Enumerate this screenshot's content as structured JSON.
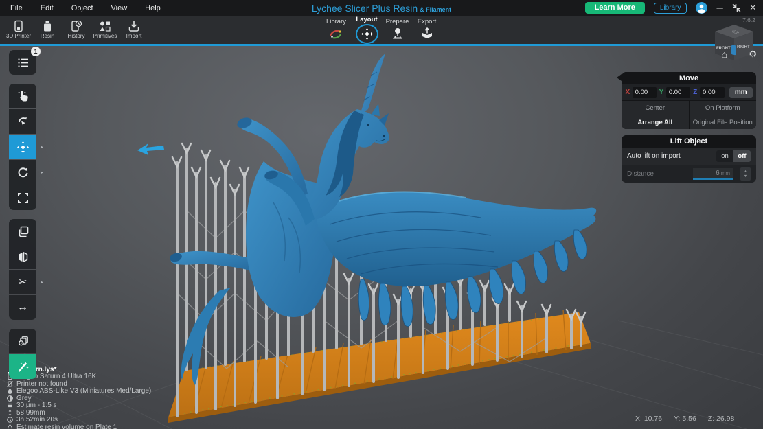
{
  "titlebar": {
    "menus": [
      "File",
      "Edit",
      "Object",
      "View",
      "Help"
    ],
    "title": "Lychee Slicer Plus Resin",
    "title_suffix": "& Filament",
    "learn_more_label": "Learn More",
    "library_label": "Library",
    "version": "7.6.2"
  },
  "toolbar": {
    "items": [
      {
        "label": "3D Printer"
      },
      {
        "label": "Resin"
      },
      {
        "label": "History"
      },
      {
        "label": "Primitives"
      },
      {
        "label": "Import"
      }
    ],
    "tabs": [
      {
        "label": "Library"
      },
      {
        "label": "Layout",
        "active": true
      },
      {
        "label": "Prepare"
      },
      {
        "label": "Export"
      }
    ]
  },
  "sidebar": {
    "scene_badge": "1"
  },
  "viewcube": {
    "top": "TOP",
    "front": "FRONT",
    "right": "RIGHT"
  },
  "panels": {
    "move": {
      "title": "Move",
      "axes": [
        {
          "label": "X",
          "value": "0.00"
        },
        {
          "label": "Y",
          "value": "0.00"
        },
        {
          "label": "Z",
          "value": "0.00"
        }
      ],
      "unit": "mm",
      "buttons": [
        "Center",
        "On Platform",
        "Arrange All",
        "Original File Position"
      ]
    },
    "lift": {
      "title": "Lift Object",
      "auto_lift_label": "Auto lift on import",
      "on_label": "on",
      "off_label": "off",
      "distance_label": "Distance",
      "distance_value": "6",
      "distance_unit": "mm"
    }
  },
  "status": {
    "lines": [
      {
        "icon": "file-icon",
        "text": "Unicorn.lys*"
      },
      {
        "icon": "printer-icon",
        "text": "Elegoo Saturn 4 Ultra 16K"
      },
      {
        "icon": "printer-not-found-icon",
        "text": "Printer not found"
      },
      {
        "icon": "resin-icon",
        "text": "Elegoo ABS-Like V3 (Miniatures Med/Large)"
      },
      {
        "icon": "color-icon",
        "text": "Grey"
      },
      {
        "icon": "layers-icon",
        "text": "30 µm - 1.5 s"
      },
      {
        "icon": "height-icon",
        "text": "58.99mm"
      },
      {
        "icon": "time-icon",
        "text": "3h 52min 20s"
      },
      {
        "icon": "volume-icon",
        "text": "Estimate resin volume on Plate 1"
      }
    ]
  },
  "coords": {
    "x": "X: 10.76",
    "y": "Y: 5.56",
    "z": "Z: 26.98"
  },
  "glyphs": {
    "minimize": "─",
    "close": "×",
    "home": "⌂",
    "gear": "⚙",
    "scissors": "✂",
    "flip": "↔",
    "chevron": "▸",
    "stepper_up": "▲",
    "stepper_down": "▼"
  },
  "colors": {
    "accent_blue": "#1f9ad6",
    "green": "#17b877",
    "magic_green": "#1cb487",
    "model_blue": "#2f83bd",
    "raft_orange": "#d8821c",
    "axis_x": "#c0443f",
    "axis_y": "#35a162",
    "axis_z": "#4a5fd0"
  }
}
